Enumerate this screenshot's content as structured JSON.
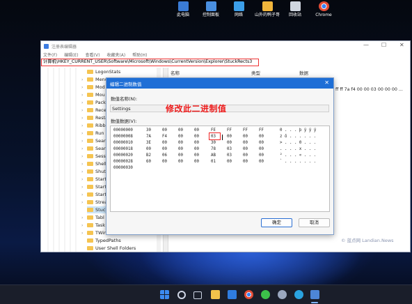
{
  "desktop": {
    "icons": [
      {
        "label": "此电脑",
        "color": "#3a7bd5"
      },
      {
        "label": "控制面板",
        "color": "#4a8fe0"
      },
      {
        "label": "网络",
        "color": "#3b9ee8"
      },
      {
        "label": "山外的鸭子哥",
        "color": "#f2b53b"
      },
      {
        "label": "回收站",
        "color": "#d0d6e0"
      },
      {
        "label": "Chrome",
        "color": "#e24b36"
      }
    ]
  },
  "window": {
    "title": "注册表编辑器",
    "menu": [
      "文件(F)",
      "编辑(E)",
      "查看(V)",
      "收藏夹(A)",
      "帮助(H)"
    ],
    "address": "计算机\\HKEY_CURRENT_USER\\Software\\Microsoft\\Windows\\CurrentVersion\\Explorer\\StuckRects3",
    "tree_items": [
      "LogonStats",
      "Menu",
      "Mod",
      "Mou",
      "Pack",
      "Rece",
      "Resta",
      "Ribbo",
      "Run",
      "Sear",
      "Sear",
      "Sess",
      "Shell",
      "Shut",
      "Start",
      "Start",
      "Start",
      "Strea",
      "Stuck",
      "Tabl",
      "Task",
      "TWin",
      "TypedPaths",
      "User Shell Folders"
    ],
    "columns": {
      "name": "名称",
      "type": "类型",
      "data": "数据"
    },
    "right_hex_value": "ff ff 7a f4 00 00 03 00 00 00 ..."
  },
  "dialog": {
    "title": "编辑二进制数值",
    "name_label": "数值名称(N):",
    "name_value": "Settings",
    "data_label": "数值数据(V):",
    "rows": [
      {
        "addr": "00000000",
        "bytes": [
          "30",
          "00",
          "00",
          "00",
          "FE",
          "FF",
          "FF",
          "FF"
        ],
        "ascii": "0 . . . þ ÿ ÿ ÿ"
      },
      {
        "addr": "00000008",
        "bytes": [
          "7A",
          "F4",
          "00",
          "00",
          "03",
          "00",
          "00",
          "00"
        ],
        "ascii": "z ô . . . . . ."
      },
      {
        "addr": "00000010",
        "bytes": [
          "3E",
          "00",
          "00",
          "00",
          "30",
          "00",
          "00",
          "00"
        ],
        "ascii": "> . . . 0 . . ."
      },
      {
        "addr": "00000018",
        "bytes": [
          "00",
          "00",
          "00",
          "00",
          "78",
          "03",
          "00",
          "00"
        ],
        "ascii": ". . . . x . . ."
      },
      {
        "addr": "00000020",
        "bytes": [
          "B2",
          "06",
          "00",
          "00",
          "AB",
          "03",
          "00",
          "00"
        ],
        "ascii": "² . . . « . . ."
      },
      {
        "addr": "00000028",
        "bytes": [
          "60",
          "00",
          "00",
          "00",
          "01",
          "00",
          "00",
          "00"
        ],
        "ascii": "` . . . . . . ."
      },
      {
        "addr": "00000030",
        "bytes": [],
        "ascii": ""
      }
    ],
    "ok_label": "确定",
    "cancel_label": "取消"
  },
  "annotation": "修改此二进制值",
  "watermark": "© 蓝点网 Landian.News",
  "taskbar": {
    "icons": [
      {
        "name": "start-icon",
        "color": "#3c8bf0"
      },
      {
        "name": "search-icon",
        "color": "#cfd6e6"
      },
      {
        "name": "taskview-icon",
        "color": "#cfd6e6"
      },
      {
        "name": "explorer-icon",
        "color": "#f2c34b"
      },
      {
        "name": "store-icon",
        "color": "#2f7de0"
      },
      {
        "name": "chrome-icon",
        "color": "#e24b36"
      },
      {
        "name": "wechat-icon",
        "color": "#3cc14a"
      },
      {
        "name": "settings-icon",
        "color": "#9aa7bf"
      },
      {
        "name": "edge-icon",
        "color": "#2aa3e0"
      },
      {
        "name": "regedit-icon",
        "color": "#4d86d6"
      }
    ]
  }
}
